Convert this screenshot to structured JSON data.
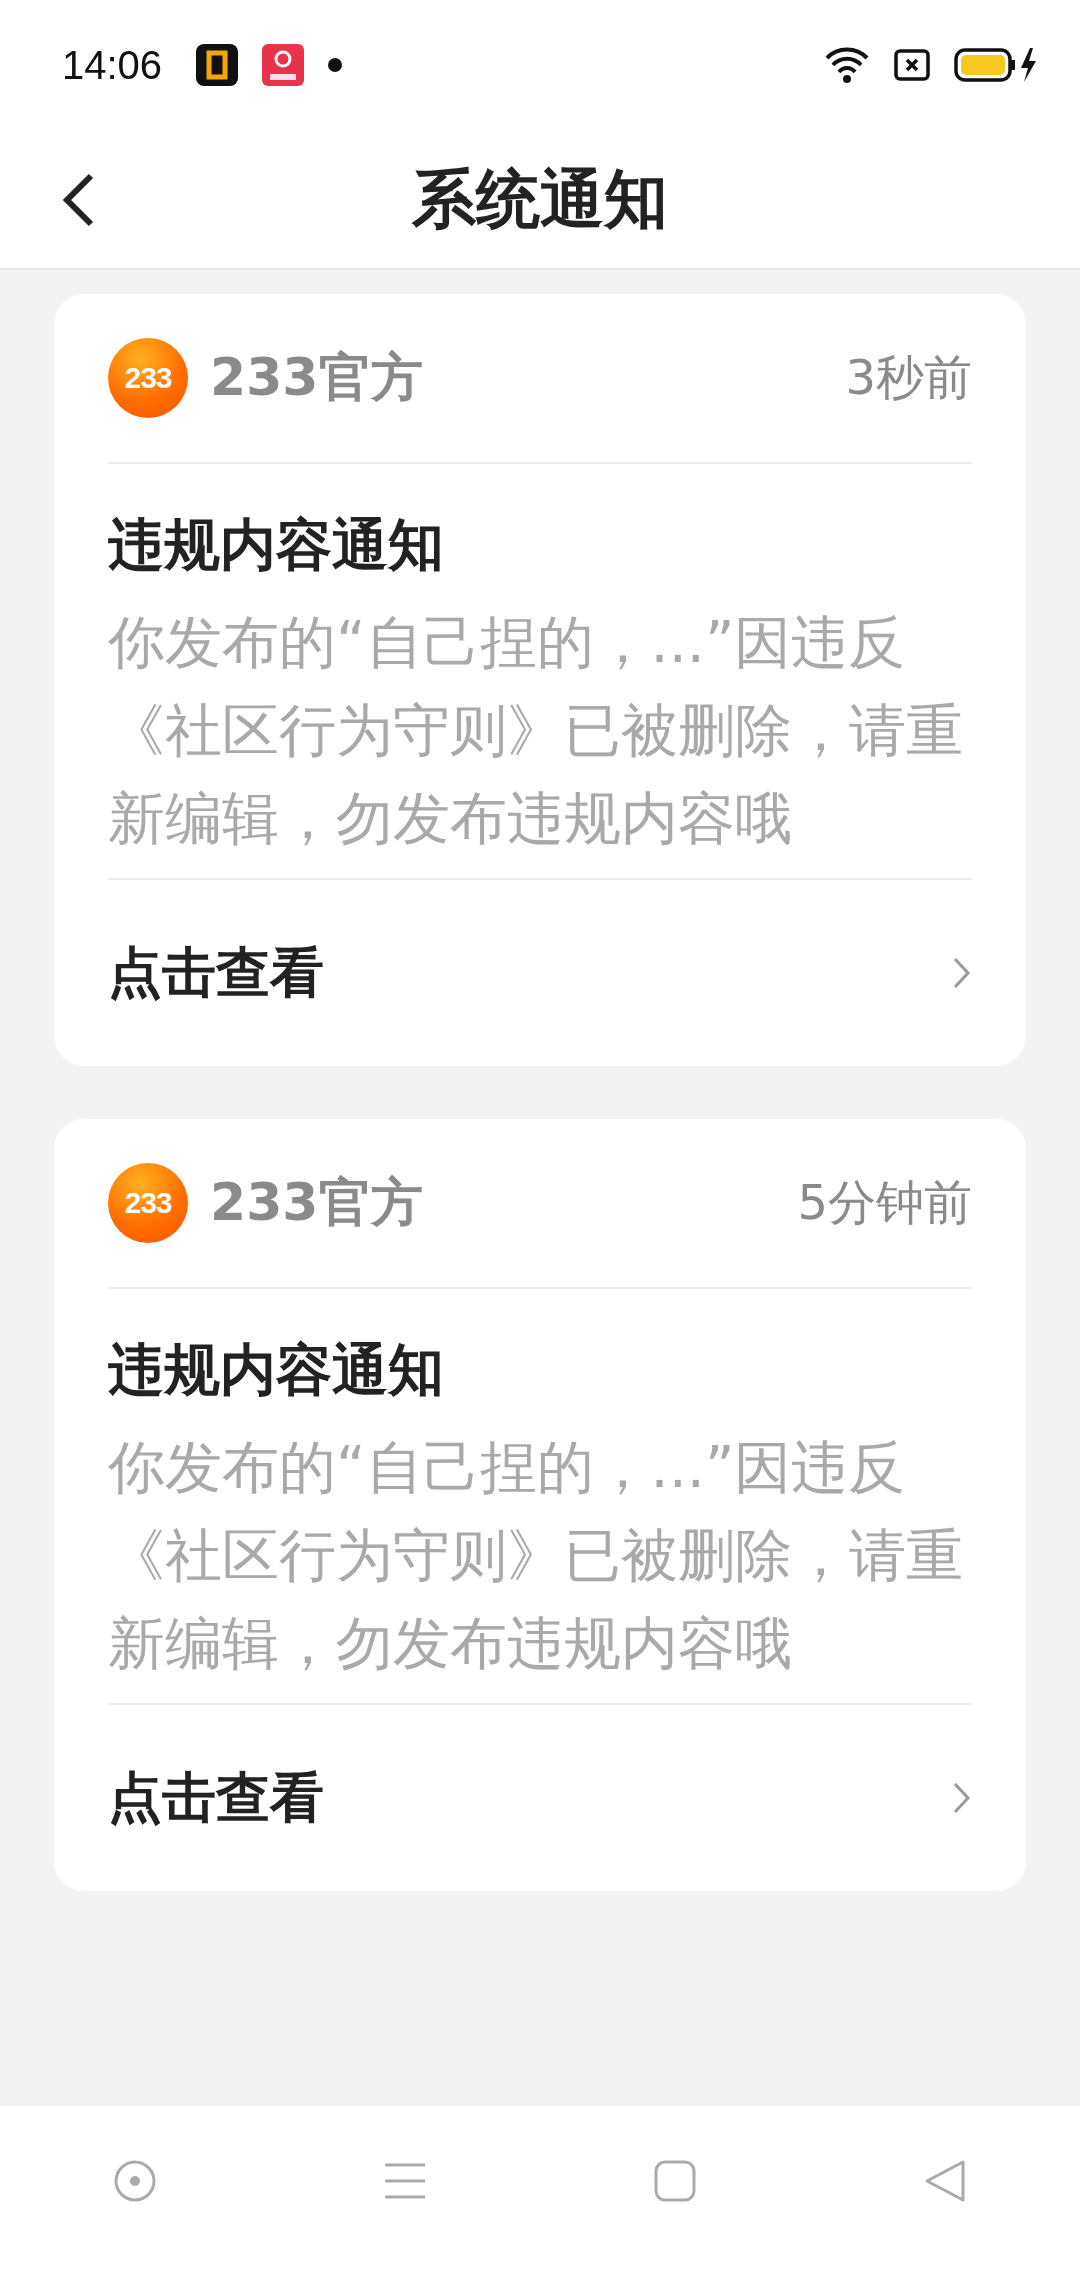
{
  "status_bar": {
    "time": "14:06"
  },
  "header": {
    "title": "系统通知"
  },
  "notifications": [
    {
      "logo_text": "233",
      "sender": "233官方",
      "time": "3秒前",
      "title": "违规内容通知",
      "body": "你发布的“自己捏的，...”因违反《社区行为守则》已被删除，请重新编辑，勿发布违规内容哦",
      "action": "点击查看"
    },
    {
      "logo_text": "233",
      "sender": "233官方",
      "time": "5分钟前",
      "title": "违规内容通知",
      "body": "你发布的“自己捏的，...”因违反《社区行为守则》已被删除，请重新编辑，勿发布违规内容哦",
      "action": "点击查看"
    }
  ]
}
